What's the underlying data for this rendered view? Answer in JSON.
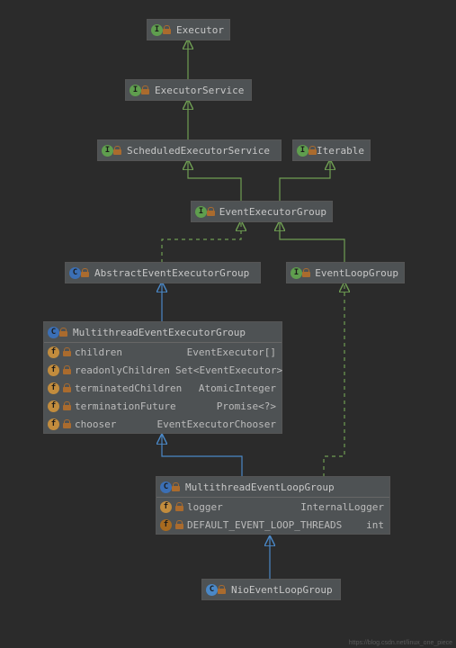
{
  "watermark": "https://blog.csdn.net/linux_one_piece",
  "icons": {
    "interface": "I",
    "classAbstract": "C",
    "classConcrete": "C",
    "field": "f",
    "finalField": "f"
  },
  "nodes": {
    "executor": {
      "kind": "interface",
      "name": "Executor"
    },
    "executorService": {
      "kind": "interface",
      "name": "ExecutorService"
    },
    "scheduledExecutorService": {
      "kind": "interface",
      "name": "ScheduledExecutorService"
    },
    "iterable": {
      "kind": "interface",
      "name": "Iterable"
    },
    "eventExecutorGroup": {
      "kind": "interface",
      "name": "EventExecutorGroup"
    },
    "abstractEventExecutorGroup": {
      "kind": "classAbstract",
      "name": "AbstractEventExecutorGroup"
    },
    "eventLoopGroup": {
      "kind": "interface",
      "name": "EventLoopGroup"
    },
    "multithreadEventExecutorGroup": {
      "kind": "classAbstract",
      "name": "MultithreadEventExecutorGroup",
      "members": [
        {
          "icon": "field",
          "name": "children",
          "type": "EventExecutor[]"
        },
        {
          "icon": "field",
          "name": "readonlyChildren",
          "type": "Set<EventExecutor>"
        },
        {
          "icon": "field",
          "name": "terminatedChildren",
          "type": "AtomicInteger"
        },
        {
          "icon": "field",
          "name": "terminationFuture",
          "type": "Promise<?>"
        },
        {
          "icon": "field",
          "name": "chooser",
          "type": "EventExecutorChooser"
        }
      ]
    },
    "multithreadEventLoopGroup": {
      "kind": "classAbstract",
      "name": "MultithreadEventLoopGroup",
      "members": [
        {
          "icon": "field",
          "name": "logger",
          "type": "InternalLogger"
        },
        {
          "icon": "finalField",
          "name": "DEFAULT_EVENT_LOOP_THREADS",
          "type": "int"
        }
      ]
    },
    "nioEventLoopGroup": {
      "kind": "classConcrete",
      "name": "NioEventLoopGroup"
    }
  },
  "connectors": [
    {
      "from": "executorService",
      "to": "executor",
      "style": "implements"
    },
    {
      "from": "scheduledExecutorService",
      "to": "executorService",
      "style": "implements"
    },
    {
      "from": "eventExecutorGroup",
      "to": "scheduledExecutorService",
      "style": "implements"
    },
    {
      "from": "eventExecutorGroup",
      "to": "iterable",
      "style": "implements"
    },
    {
      "from": "abstractEventExecutorGroup",
      "to": "eventExecutorGroup",
      "style": "implementsDashed"
    },
    {
      "from": "eventLoopGroup",
      "to": "eventExecutorGroup",
      "style": "implements"
    },
    {
      "from": "multithreadEventExecutorGroup",
      "to": "abstractEventExecutorGroup",
      "style": "extends"
    },
    {
      "from": "multithreadEventLoopGroup",
      "to": "multithreadEventExecutorGroup",
      "style": "extends"
    },
    {
      "from": "multithreadEventLoopGroup",
      "to": "eventLoopGroup",
      "style": "implementsDashed"
    },
    {
      "from": "nioEventLoopGroup",
      "to": "multithreadEventLoopGroup",
      "style": "extends"
    }
  ]
}
